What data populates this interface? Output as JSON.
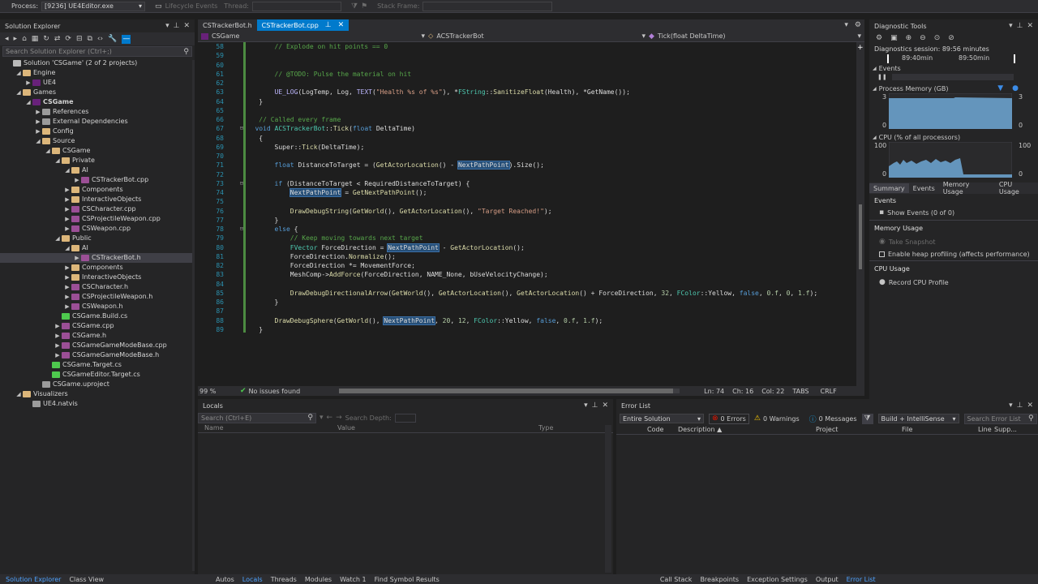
{
  "topbar": {
    "process_label": "Process:",
    "process_value": "[9236] UE4Editor.exe",
    "lifecycle": "Lifecycle Events",
    "thread": "Thread:",
    "stack": "Stack Frame:"
  },
  "se": {
    "title": "Solution Explorer",
    "search": "Search Solution Explorer (Ctrl+;)",
    "items": [
      {
        "d": 0,
        "a": "",
        "t": "Solution 'CSGame' (2 of 2 projects)",
        "c": "#b9b9b9",
        "b": false
      },
      {
        "d": 1,
        "a": "◢",
        "t": "Engine",
        "c": "#dcb67a",
        "b": false
      },
      {
        "d": 2,
        "a": "▶",
        "t": "UE4",
        "c": "#68217a",
        "b": false
      },
      {
        "d": 1,
        "a": "◢",
        "t": "Games",
        "c": "#dcb67a",
        "b": false
      },
      {
        "d": 2,
        "a": "◢",
        "t": "CSGame",
        "c": "#68217a",
        "b": true
      },
      {
        "d": 3,
        "a": "▶",
        "t": "References",
        "c": "#9b9b9b",
        "b": false
      },
      {
        "d": 3,
        "a": "▶",
        "t": "External Dependencies",
        "c": "#9b9b9b",
        "b": false
      },
      {
        "d": 3,
        "a": "▶",
        "t": "Config",
        "c": "#dcb67a",
        "b": false
      },
      {
        "d": 3,
        "a": "◢",
        "t": "Source",
        "c": "#dcb67a",
        "b": false
      },
      {
        "d": 4,
        "a": "◢",
        "t": "CSGame",
        "c": "#dcb67a",
        "b": false
      },
      {
        "d": 5,
        "a": "◢",
        "t": "Private",
        "c": "#dcb67a",
        "b": false
      },
      {
        "d": 6,
        "a": "◢",
        "t": "AI",
        "c": "#dcb67a",
        "b": false
      },
      {
        "d": 7,
        "a": "▶",
        "t": "CSTrackerBot.cpp",
        "c": "#9b4f96",
        "b": false
      },
      {
        "d": 6,
        "a": "▶",
        "t": "Components",
        "c": "#dcb67a",
        "b": false
      },
      {
        "d": 6,
        "a": "▶",
        "t": "InteractiveObjects",
        "c": "#dcb67a",
        "b": false
      },
      {
        "d": 6,
        "a": "▶",
        "t": "CSCharacter.cpp",
        "c": "#9b4f96",
        "b": false
      },
      {
        "d": 6,
        "a": "▶",
        "t": "CSProjectileWeapon.cpp",
        "c": "#9b4f96",
        "b": false
      },
      {
        "d": 6,
        "a": "▶",
        "t": "CSWeapon.cpp",
        "c": "#9b4f96",
        "b": false
      },
      {
        "d": 5,
        "a": "◢",
        "t": "Public",
        "c": "#dcb67a",
        "b": false
      },
      {
        "d": 6,
        "a": "◢",
        "t": "AI",
        "c": "#dcb67a",
        "b": false
      },
      {
        "d": 7,
        "a": "▶",
        "t": "CSTrackerBot.h",
        "c": "#9b4f96",
        "b": false,
        "sel": true
      },
      {
        "d": 6,
        "a": "▶",
        "t": "Components",
        "c": "#dcb67a",
        "b": false
      },
      {
        "d": 6,
        "a": "▶",
        "t": "InteractiveObjects",
        "c": "#dcb67a",
        "b": false
      },
      {
        "d": 6,
        "a": "▶",
        "t": "CSCharacter.h",
        "c": "#9b4f96",
        "b": false
      },
      {
        "d": 6,
        "a": "▶",
        "t": "CSProjectileWeapon.h",
        "c": "#9b4f96",
        "b": false
      },
      {
        "d": 6,
        "a": "▶",
        "t": "CSWeapon.h",
        "c": "#9b4f96",
        "b": false
      },
      {
        "d": 5,
        "a": "",
        "t": "CSGame.Build.cs",
        "c": "#4ec94e",
        "b": false
      },
      {
        "d": 5,
        "a": "▶",
        "t": "CSGame.cpp",
        "c": "#9b4f96",
        "b": false
      },
      {
        "d": 5,
        "a": "▶",
        "t": "CSGame.h",
        "c": "#9b4f96",
        "b": false
      },
      {
        "d": 5,
        "a": "▶",
        "t": "CSGameGameModeBase.cpp",
        "c": "#9b4f96",
        "b": false
      },
      {
        "d": 5,
        "a": "▶",
        "t": "CSGameGameModeBase.h",
        "c": "#9b4f96",
        "b": false
      },
      {
        "d": 4,
        "a": "",
        "t": "CSGame.Target.cs",
        "c": "#4ec94e",
        "b": false
      },
      {
        "d": 4,
        "a": "",
        "t": "CSGameEditor.Target.cs",
        "c": "#4ec94e",
        "b": false
      },
      {
        "d": 3,
        "a": "",
        "t": "CSGame.uproject",
        "c": "#9b9b9b",
        "b": false
      },
      {
        "d": 1,
        "a": "◢",
        "t": "Visualizers",
        "c": "#dcb67a",
        "b": false
      },
      {
        "d": 2,
        "a": "",
        "t": "UE4.natvis",
        "c": "#9b9b9b",
        "b": false
      }
    ]
  },
  "editor": {
    "tabs": [
      {
        "label": "CSTrackerBot.h",
        "active": false
      },
      {
        "label": "CSTrackerBot.cpp",
        "active": true
      }
    ],
    "nav": {
      "project": "CSGame",
      "class": "ACSTrackerBot",
      "member": "Tick(float DeltaTime)"
    },
    "lines": [
      {
        "n": "58",
        "h": "        <span class='cm'>// Explode on hit points == 0</span>"
      },
      {
        "n": "59",
        "h": ""
      },
      {
        "n": "60",
        "h": ""
      },
      {
        "n": "61",
        "h": "        <span class='cm'>// @TODO: Pulse the material on hit</span>"
      },
      {
        "n": "62",
        "h": ""
      },
      {
        "n": "63",
        "h": "        <span class='mac'>UE_LOG</span>(LogTemp, Log, <span class='mac'>TEXT</span>(<span class='st'>\"Health %s of %s\"</span>), *<span class='ty'>FString</span>::<span class='fn'>SanitizeFloat</span>(Health), *GetName());"
      },
      {
        "n": "64",
        "h": "    }"
      },
      {
        "n": "65",
        "h": ""
      },
      {
        "n": "66",
        "h": "    <span class='cm'>// Called every frame</span>"
      },
      {
        "n": "67",
        "h": "   <span class='kw'>void</span> <span class='ty'>ACSTrackerBot</span>::<span class='fn'>Tick</span>(<span class='kw'>float</span> DeltaTime)"
      },
      {
        "n": "68",
        "h": "    {"
      },
      {
        "n": "69",
        "h": "        Super::<span class='fn'>Tick</span>(DeltaTime);"
      },
      {
        "n": "70",
        "h": ""
      },
      {
        "n": "71",
        "h": "        <span class='kw'>float</span> DistanceToTarget = (<span class='fn'>GetActorLocation</span>() - <span class='hl'>NextPathPoint</span>).Size();"
      },
      {
        "n": "72",
        "h": ""
      },
      {
        "n": "73",
        "h": "        <span class='kw'>if</span> (DistanceToTarget &lt; RequiredDistanceToTarget) {"
      },
      {
        "n": "74",
        "h": "            <span class='hl'>NextPathPoint</span> = <span class='fn'>GetNextPathPoint</span>();"
      },
      {
        "n": "75",
        "h": ""
      },
      {
        "n": "76",
        "h": "            <span class='fn'>DrawDebugString</span>(<span class='fn'>GetWorld</span>(), <span class='fn'>GetActorLocation</span>(), <span class='st'>\"Target Reached!\"</span>);"
      },
      {
        "n": "77",
        "h": "        }"
      },
      {
        "n": "78",
        "h": "        <span class='kw'>else</span> {"
      },
      {
        "n": "79",
        "h": "            <span class='cm'>// Keep moving towards next target</span>"
      },
      {
        "n": "80",
        "h": "            <span class='ty'>FVector</span> ForceDirection = <span class='hl'>NextPathPoint</span> - <span class='fn'>GetActorLocation</span>();"
      },
      {
        "n": "81",
        "h": "            ForceDirection.<span class='fn'>Normalize</span>();"
      },
      {
        "n": "82",
        "h": "            ForceDirection *= MovementForce;"
      },
      {
        "n": "83",
        "h": "            MeshComp-&gt;<span class='fn'>AddForce</span>(ForceDirection, NAME_None, bUseVelocityChange);"
      },
      {
        "n": "84",
        "h": ""
      },
      {
        "n": "85",
        "h": "            <span class='fn'>DrawDebugDirectionalArrow</span>(<span class='fn'>GetWorld</span>(), <span class='fn'>GetActorLocation</span>(), <span class='fn'>GetActorLocation</span>() + ForceDirection, <span class='nm'>32</span>, <span class='ty'>FColor</span>::Yellow, <span class='kw'>false</span>, <span class='nm'>0.f</span>, <span class='nm'>0</span>, <span class='nm'>1.f</span>);"
      },
      {
        "n": "86",
        "h": "        }"
      },
      {
        "n": "87",
        "h": ""
      },
      {
        "n": "88",
        "h": "        <span class='fn'>DrawDebugSphere</span>(<span class='fn'>GetWorld</span>(), <span class='hl'>NextPathPoint</span>, <span class='nm'>20</span>, <span class='nm'>12</span>, <span class='ty'>FColor</span>::Yellow, <span class='kw'>false</span>, <span class='nm'>0.f</span>, <span class='nm'>1.f</span>);"
      },
      {
        "n": "89",
        "h": "    }"
      }
    ],
    "status": {
      "zoom": "99 %",
      "issues": "No issues found",
      "ln": "Ln: 74",
      "ch": "Ch: 16",
      "col": "Col: 22",
      "tabs": "TABS",
      "crlf": "CRLF"
    }
  },
  "diag": {
    "title": "Diagnostic Tools",
    "session": "Diagnostics session: 89:56 minutes",
    "t1": "89:40min",
    "t2": "89:50min",
    "events": "Events",
    "pm": "Process Memory (GB)",
    "pm_max": "3",
    "pm_min": "0",
    "cpu": "CPU (% of all processors)",
    "cpu_max": "100",
    "cpu_min": "0",
    "tabs": [
      "Summary",
      "Events",
      "Memory Usage",
      "CPU Usage"
    ],
    "s_events": "Events",
    "show_events": "Show Events (0 of 0)",
    "s_mem": "Memory Usage",
    "snapshot": "Take Snapshot",
    "heap": "Enable heap profiling (affects performance)",
    "s_cpu": "CPU Usage",
    "record": "Record CPU Profile"
  },
  "locals": {
    "title": "Locals",
    "search": "Search (Ctrl+E)",
    "depth": "Search Depth:",
    "cols": [
      "Name",
      "Value",
      "Type"
    ]
  },
  "errors": {
    "title": "Error List",
    "scope": "Entire Solution",
    "errors": "0 Errors",
    "warnings": "0 Warnings",
    "messages": "0 Messages",
    "build": "Build + IntelliSense",
    "search": "Search Error List",
    "cols": [
      "Code",
      "Description",
      "Project",
      "File",
      "Line",
      "Supp..."
    ]
  },
  "bottom": {
    "left": [
      "Solution Explorer",
      "Class View"
    ],
    "mid": [
      "Autos",
      "Locals",
      "Threads",
      "Modules",
      "Watch 1",
      "Find Symbol Results"
    ],
    "right": [
      "Call Stack",
      "Breakpoints",
      "Exception Settings",
      "Output",
      "Error List"
    ]
  }
}
